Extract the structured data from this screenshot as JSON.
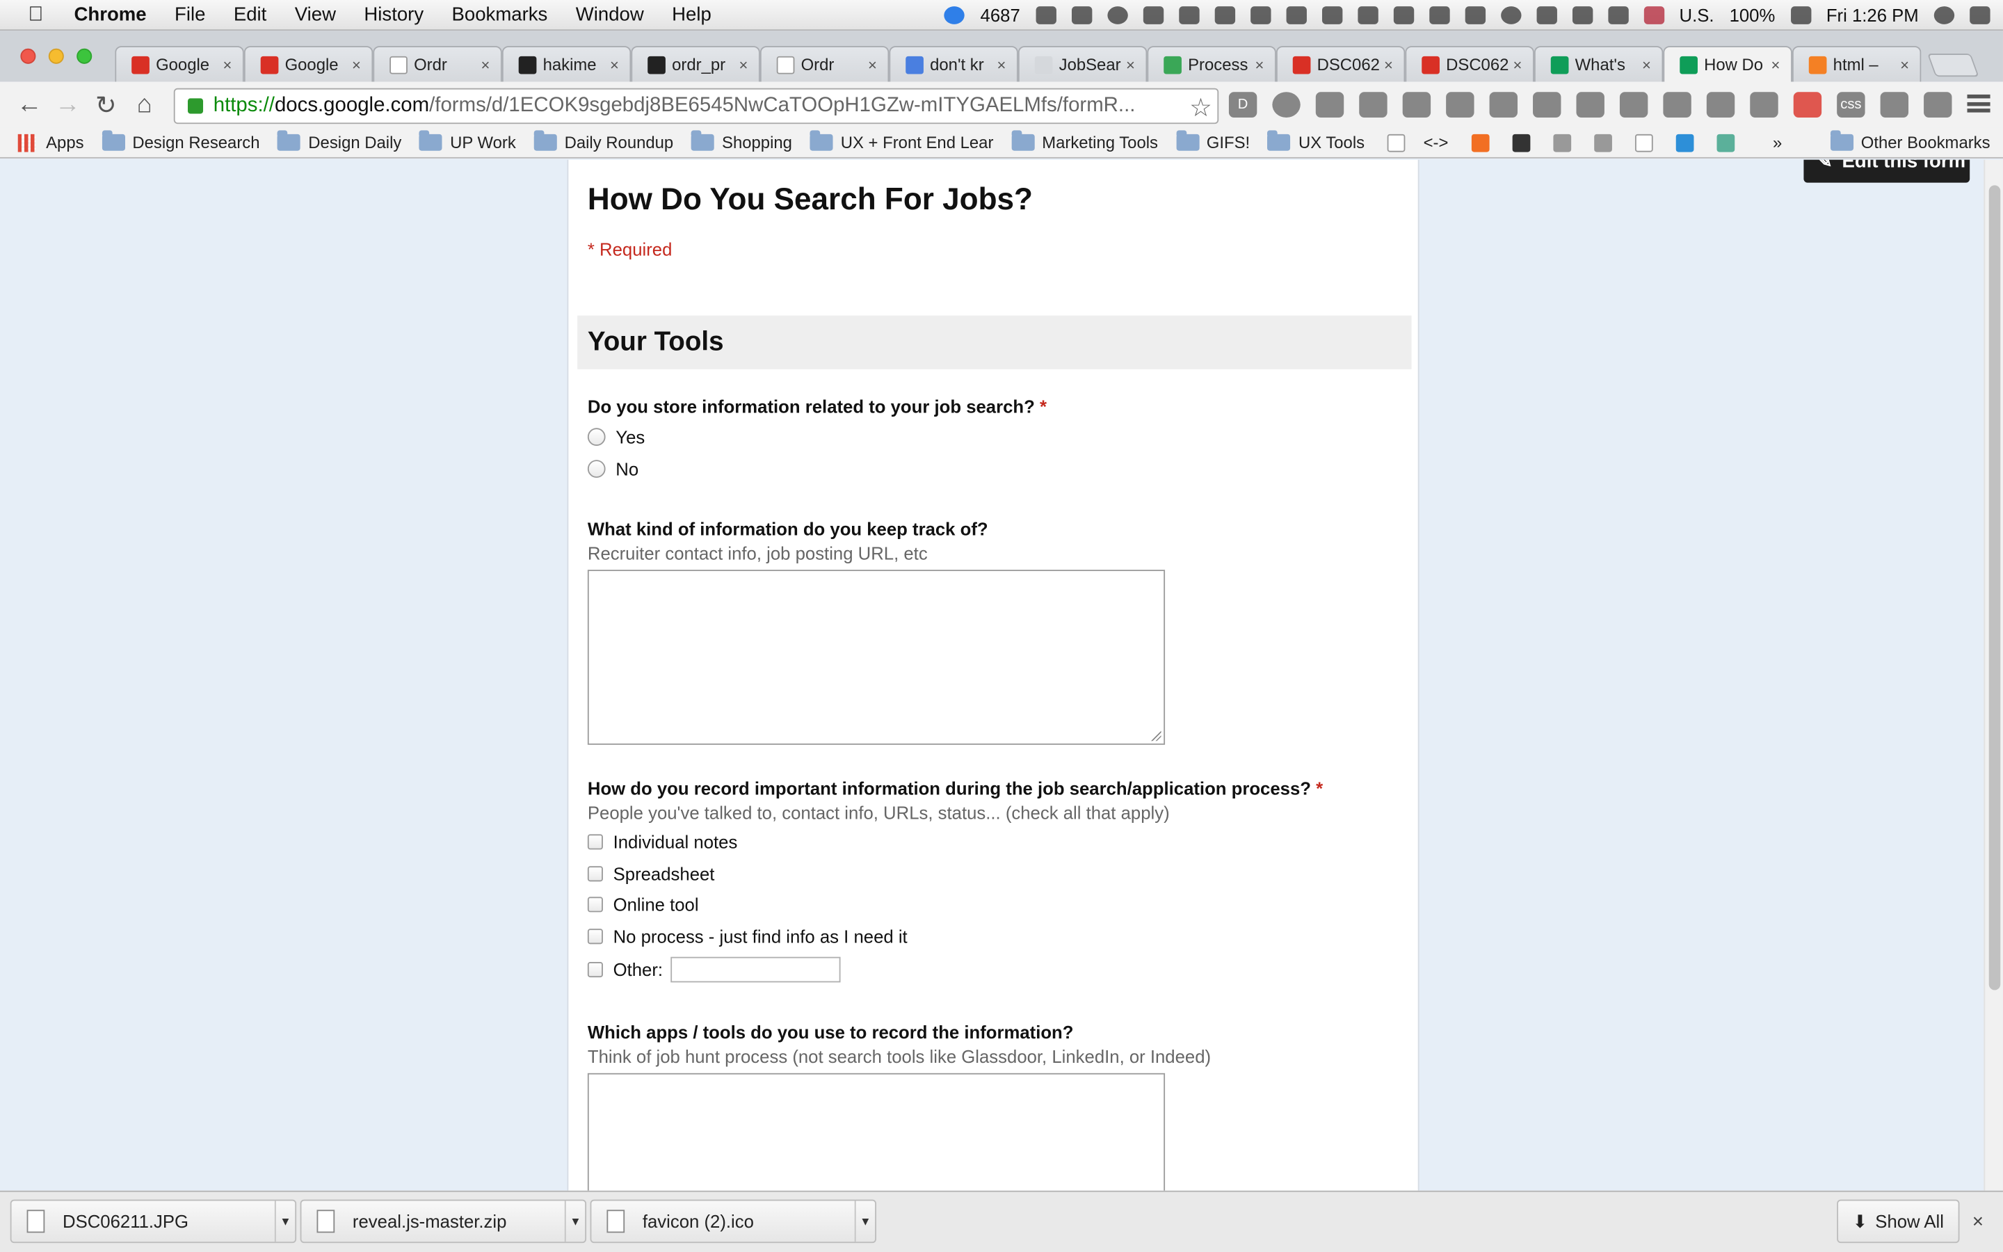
{
  "menubar": {
    "app": "Chrome",
    "items": [
      "File",
      "Edit",
      "View",
      "History",
      "Bookmarks",
      "Window",
      "Help"
    ],
    "status_count": "4687",
    "input_source": "U.S.",
    "battery": "100%",
    "clock": "Fri 1:26 PM"
  },
  "tabs": [
    {
      "label": "Google",
      "icon": "google-docs-icon",
      "color": "#d93025"
    },
    {
      "label": "Google",
      "icon": "google-docs-icon",
      "color": "#d93025"
    },
    {
      "label": "Ordr",
      "icon": "page-icon",
      "color": "#ffffff"
    },
    {
      "label": "hakime",
      "icon": "github-icon",
      "color": "#222222"
    },
    {
      "label": "ordr_pr",
      "icon": "github-icon",
      "color": "#222222"
    },
    {
      "label": "Ordr",
      "icon": "page-icon",
      "color": "#ffffff"
    },
    {
      "label": "don't kr",
      "icon": "google-search-icon",
      "color": "#4a7fe0"
    },
    {
      "label": "JobSear",
      "icon": "none",
      "color": "#d5d8dc"
    },
    {
      "label": "Process",
      "icon": "google-drive-icon",
      "color": "#3aa757"
    },
    {
      "label": "DSC062",
      "icon": "image-icon",
      "color": "#d93025"
    },
    {
      "label": "DSC062",
      "icon": "image-icon",
      "color": "#d93025"
    },
    {
      "label": "What's",
      "icon": "google-forms-icon",
      "color": "#0f9d58"
    },
    {
      "label": "How Do",
      "icon": "google-forms-icon",
      "color": "#0f9d58",
      "active": true
    },
    {
      "label": "html –",
      "icon": "stackoverflow-icon",
      "color": "#f48024"
    }
  ],
  "toolbar": {
    "url_scheme": "https://",
    "url_host": "docs.google.com",
    "url_path": "/forms/d/1ECOK9sgebdj8BE6545NwCaTOOpH1GZw-mITYGAELMfs/formR..."
  },
  "bookmarks": {
    "apps": "Apps",
    "folders": [
      "Design Research",
      "Design Daily",
      "UP Work",
      "Daily Roundup",
      "Shopping",
      "UX + Front End Lear",
      "Marketing Tools",
      "GIFS!",
      "UX Tools"
    ],
    "code_link": "<->",
    "overflow": "»",
    "other": "Other Bookmarks"
  },
  "form": {
    "edit_button": "Edit this form",
    "title": "How Do You Search For Jobs?",
    "required_note": "* Required",
    "section_title": "Your Tools",
    "q1": {
      "label": "Do you store information related to your job search?",
      "required_mark": "*",
      "options": [
        "Yes",
        "No"
      ]
    },
    "q2": {
      "label": "What kind of information do you keep track of?",
      "help": "Recruiter contact info, job posting URL, etc"
    },
    "q3": {
      "label": "How do you record important information during the job search/application process?",
      "required_mark": "*",
      "help": "People you've talked to, contact info, URLs, status... (check all that apply)",
      "options": [
        "Individual notes",
        "Spreadsheet",
        "Online tool",
        "No process - just find info as I need it",
        "Other:"
      ]
    },
    "q4": {
      "label": "Which apps / tools do you use to record the information?",
      "help": "Think of job hunt process (not search tools like Glassdoor, LinkedIn, or Indeed)"
    }
  },
  "downloads": {
    "items": [
      "DSC06211.JPG",
      "reveal.js-master.zip",
      "favicon (2).ico"
    ],
    "show_all": "Show All",
    "close": "×"
  }
}
